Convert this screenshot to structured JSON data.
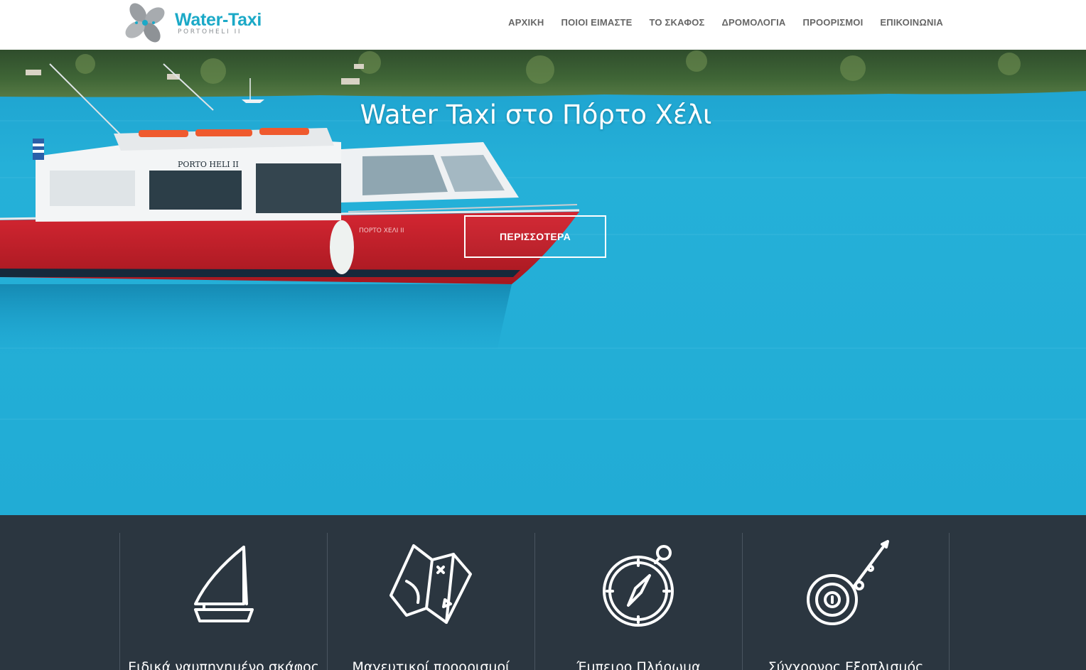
{
  "header": {
    "logo": {
      "word": "Water-Taxi",
      "sub": "PORTOHELI II"
    },
    "nav": [
      {
        "label": "ΑΡΧΙΚΗ"
      },
      {
        "label": "ΠΟΙΟΙ ΕΙΜΑΣΤΕ"
      },
      {
        "label": "ΤΟ ΣΚΑΦΟΣ"
      },
      {
        "label": "ΔΡΟΜΟΛΟΓΙΑ"
      },
      {
        "label": "ΠΡΟΟΡΙΣΜΟΙ"
      },
      {
        "label": "ΕΠΙΚΟΙΝΩΝΙΑ"
      }
    ]
  },
  "hero": {
    "title": "Water Taxi στο Πόρτο Χέλι",
    "button": "ΠΕΡΙΣΣΟΤΕΡΑ",
    "boat_name": "PORTO HELI II",
    "boat_hull_text": "ΠΟΡΤΟ ΧΕΛΙ II"
  },
  "features": [
    {
      "label": "Ειδικά ναυπηγημένο σκάφος",
      "icon": "sailboat-icon"
    },
    {
      "label": "Μαγευτικοί προορισμοί",
      "icon": "treasure-map-icon"
    },
    {
      "label": "Έμπειρο Πλήρωμα",
      "icon": "compass-icon"
    },
    {
      "label": "Σύγχρονος Εξοπλισμός",
      "icon": "fishing-reel-icon"
    }
  ],
  "colors": {
    "brand": "#1ba9c7",
    "nav_text": "#666666",
    "sea": "#29b6dc",
    "features_bg": "#2b3640",
    "boat_hull": "#c8202a"
  }
}
